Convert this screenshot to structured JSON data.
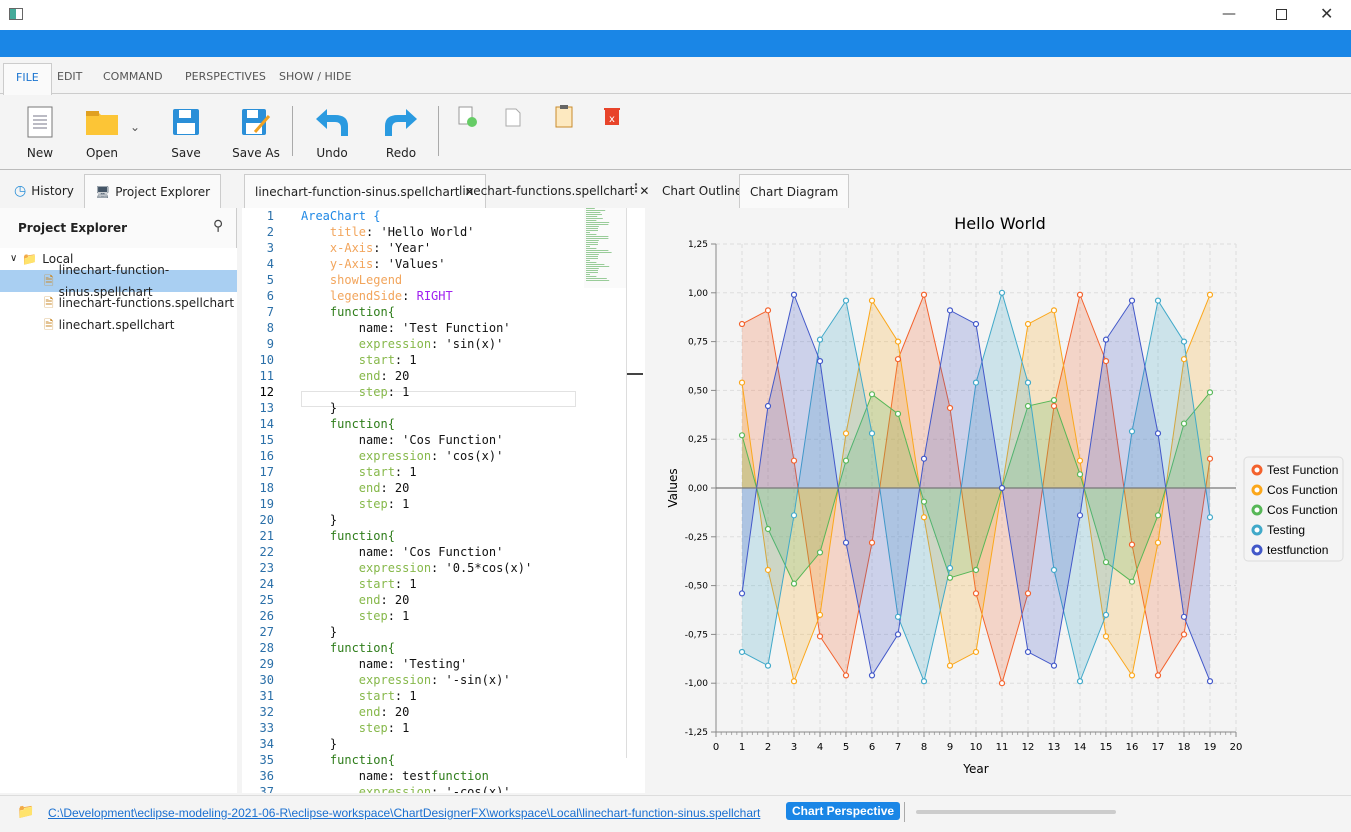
{
  "window": {
    "controls": [
      "minimize",
      "maximize",
      "close"
    ]
  },
  "menu": {
    "tabs": [
      "FILE",
      "EDIT",
      "COMMAND",
      "PERSPECTIVES",
      "SHOW / HIDE"
    ],
    "active": 0
  },
  "toolbar": {
    "new": "New",
    "open": "Open",
    "save": "Save",
    "save_as": "Save As",
    "undo": "Undo",
    "redo": "Redo"
  },
  "left_panel": {
    "tabs": [
      "History",
      "Project Explorer"
    ],
    "title": "Project Explorer",
    "root": "Local",
    "files": [
      "linechart-function-sinus.spellchart",
      "linechart-functions.spellchart",
      "linechart.spellchart"
    ],
    "selected": 0
  },
  "editor": {
    "tabs": [
      "linechart-function-sinus.spellchart",
      "linechart-functions.spellchart"
    ],
    "lines": [
      [
        [
          "AreaChart {",
          "type"
        ]
      ],
      [
        [
          "    "
        ],
        [
          "title",
          "prop"
        ],
        [
          ": 'Hello World'",
          "txt"
        ]
      ],
      [
        [
          "    "
        ],
        [
          "x-Axis",
          "prop"
        ],
        [
          ": 'Year'",
          "txt"
        ]
      ],
      [
        [
          "    "
        ],
        [
          "y-Axis",
          "prop"
        ],
        [
          ": 'Values'",
          "txt"
        ]
      ],
      [
        [
          "    "
        ],
        [
          "showLegend",
          "prop"
        ]
      ],
      [
        [
          "    "
        ],
        [
          "legendSide",
          "prop"
        ],
        [
          ": ",
          "txt"
        ],
        [
          "RIGHT",
          "enum"
        ]
      ],
      [
        [
          "    "
        ],
        [
          "function",
          "fn"
        ],
        [
          "{",
          "fn"
        ]
      ],
      [
        [
          "        "
        ],
        [
          "name: 'Test Function'",
          "txt"
        ]
      ],
      [
        [
          "        "
        ],
        [
          "expression",
          "attr"
        ],
        [
          ": 'sin(x)'",
          "txt"
        ]
      ],
      [
        [
          "        "
        ],
        [
          "start",
          "attr"
        ],
        [
          ": 1",
          "txt"
        ]
      ],
      [
        [
          "        "
        ],
        [
          "end",
          "attr"
        ],
        [
          ": 20",
          "txt"
        ]
      ],
      [
        [
          "        "
        ],
        [
          "step",
          "attr"
        ],
        [
          ": 1",
          "txt"
        ]
      ],
      [
        [
          "    "
        ],
        [
          "}",
          "txt"
        ]
      ],
      [
        [
          "    "
        ],
        [
          "function",
          "fn"
        ],
        [
          "{",
          "fn"
        ]
      ],
      [
        [
          "        "
        ],
        [
          "name: 'Cos Function'",
          "txt"
        ]
      ],
      [
        [
          "        "
        ],
        [
          "expression",
          "attr"
        ],
        [
          ": 'cos(x)'",
          "txt"
        ]
      ],
      [
        [
          "        "
        ],
        [
          "start",
          "attr"
        ],
        [
          ": 1",
          "txt"
        ]
      ],
      [
        [
          "        "
        ],
        [
          "end",
          "attr"
        ],
        [
          ": 20",
          "txt"
        ]
      ],
      [
        [
          "        "
        ],
        [
          "step",
          "attr"
        ],
        [
          ": 1",
          "txt"
        ]
      ],
      [
        [
          "    "
        ],
        [
          "}",
          "txt"
        ]
      ],
      [
        [
          "    "
        ],
        [
          "function",
          "fn"
        ],
        [
          "{",
          "fn"
        ]
      ],
      [
        [
          "        "
        ],
        [
          "name: 'Cos Function'",
          "txt"
        ]
      ],
      [
        [
          "        "
        ],
        [
          "expression",
          "attr"
        ],
        [
          ": '0.5*cos(x)'",
          "txt"
        ]
      ],
      [
        [
          "        "
        ],
        [
          "start",
          "attr"
        ],
        [
          ": 1",
          "txt"
        ]
      ],
      [
        [
          "        "
        ],
        [
          "end",
          "attr"
        ],
        [
          ": 20",
          "txt"
        ]
      ],
      [
        [
          "        "
        ],
        [
          "step",
          "attr"
        ],
        [
          ": 1",
          "txt"
        ]
      ],
      [
        [
          "    "
        ],
        [
          "}",
          "txt"
        ]
      ],
      [
        [
          "    "
        ],
        [
          "function",
          "fn"
        ],
        [
          "{",
          "fn"
        ]
      ],
      [
        [
          "        "
        ],
        [
          "name: 'Testing'",
          "txt"
        ]
      ],
      [
        [
          "        "
        ],
        [
          "expression",
          "attr"
        ],
        [
          ": '-sin(x)'",
          "txt"
        ]
      ],
      [
        [
          "        "
        ],
        [
          "start",
          "attr"
        ],
        [
          ": 1",
          "txt"
        ]
      ],
      [
        [
          "        "
        ],
        [
          "end",
          "attr"
        ],
        [
          ": 20",
          "txt"
        ]
      ],
      [
        [
          "        "
        ],
        [
          "step",
          "attr"
        ],
        [
          ": 1",
          "txt"
        ]
      ],
      [
        [
          "    "
        ],
        [
          "}",
          "txt"
        ]
      ],
      [
        [
          "    "
        ],
        [
          "function",
          "fn"
        ],
        [
          "{",
          "fn"
        ]
      ],
      [
        [
          "        "
        ],
        [
          "name: test",
          "txt"
        ],
        [
          "function",
          "fn"
        ]
      ],
      [
        [
          "        "
        ],
        [
          "expression",
          "attr"
        ],
        [
          ": '-cos(x)'",
          "txt"
        ]
      ]
    ],
    "current_line": 12
  },
  "chart_panel": {
    "tabs": [
      "Chart Outline",
      "Chart Diagram"
    ],
    "active": 1
  },
  "status": {
    "path": "C:\\Development\\eclipse-modeling-2021-06-R\\eclipse-workspace\\ChartDesignerFX\\workspace\\Local\\linechart-function-sinus.spellchart",
    "perspective": "Chart Perspective"
  },
  "colors": {
    "accent": "#1a86e6"
  },
  "chart_data": {
    "type": "area",
    "title": "Hello World",
    "xlabel": "Year",
    "ylabel": "Values",
    "xlim": [
      0,
      20
    ],
    "ylim": [
      -1.25,
      1.25
    ],
    "xticks": [
      0,
      1,
      2,
      3,
      4,
      5,
      6,
      7,
      8,
      9,
      10,
      11,
      12,
      13,
      14,
      15,
      16,
      17,
      18,
      19,
      20
    ],
    "yticks": [
      "-1,25",
      "-1,00",
      "-0,75",
      "-0,50",
      "-0,25",
      "0,00",
      "0,25",
      "0,50",
      "0,75",
      "1,00",
      "1,25"
    ],
    "grid": true,
    "legend": "right",
    "x": [
      1,
      2,
      3,
      4,
      5,
      6,
      7,
      8,
      9,
      10,
      11,
      12,
      13,
      14,
      15,
      16,
      17,
      18,
      19
    ],
    "series": [
      {
        "name": "Test Function",
        "color": "#f3622d",
        "values": [
          0.84,
          0.91,
          0.14,
          -0.76,
          -0.96,
          -0.28,
          0.66,
          0.99,
          0.41,
          -0.54,
          -1.0,
          -0.54,
          0.42,
          0.99,
          0.65,
          -0.29,
          -0.96,
          -0.75,
          0.15
        ]
      },
      {
        "name": "Cos Function",
        "color": "#fba71b",
        "values": [
          0.54,
          -0.42,
          -0.99,
          -0.65,
          0.28,
          0.96,
          0.75,
          -0.15,
          -0.91,
          -0.84,
          0.0,
          0.84,
          0.91,
          0.14,
          -0.76,
          -0.96,
          -0.28,
          0.66,
          0.99
        ]
      },
      {
        "name": "Cos Function",
        "color": "#57b757",
        "values": [
          0.27,
          -0.21,
          -0.49,
          -0.33,
          0.14,
          0.48,
          0.38,
          -0.07,
          -0.46,
          -0.42,
          0.0,
          0.42,
          0.45,
          0.07,
          -0.38,
          -0.48,
          -0.14,
          0.33,
          0.49
        ]
      },
      {
        "name": "Testing",
        "color": "#41a9c9",
        "values": [
          -0.84,
          -0.91,
          -0.14,
          0.76,
          0.96,
          0.28,
          -0.66,
          -0.99,
          -0.41,
          0.54,
          1.0,
          0.54,
          -0.42,
          -0.99,
          -0.65,
          0.29,
          0.96,
          0.75,
          -0.15
        ]
      },
      {
        "name": "testfunction",
        "color": "#4258c9",
        "values": [
          -0.54,
          0.42,
          0.99,
          0.65,
          -0.28,
          -0.96,
          -0.75,
          0.15,
          0.91,
          0.84,
          0.0,
          -0.84,
          -0.91,
          -0.14,
          0.76,
          0.96,
          0.28,
          -0.66,
          -0.99
        ]
      }
    ]
  }
}
